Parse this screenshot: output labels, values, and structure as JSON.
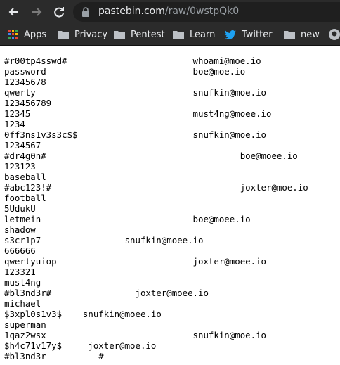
{
  "browser": {
    "url_host": "pastebin.com",
    "url_path": "/raw/0wstpQk0"
  },
  "bookmarks": [
    {
      "label": "Apps",
      "icon": "apps-grid-icon"
    },
    {
      "label": "Privacy",
      "icon": "folder-icon"
    },
    {
      "label": "Pentest",
      "icon": "folder-icon"
    },
    {
      "label": "Learn",
      "icon": "folder-icon"
    },
    {
      "label": "Twitter",
      "icon": "twitter-icon"
    },
    {
      "label": "new",
      "icon": "folder-icon"
    }
  ],
  "lines": [
    "#r00tp4sswd#                        whoami@moe.io",
    "password                            boe@moe.io",
    "12345678",
    "qwerty                              snufkin@moe.io",
    "123456789",
    "12345                               must4ng@moee.io",
    "1234",
    "0ff3ns1v3s3c$$                      snufkin@moe.io",
    "1234567",
    "#dr4g0n#                                     boe@moee.io",
    "123123",
    "baseball",
    "#abc123!#                                    joxter@moe.io",
    "football",
    "5UdukU",
    "letmein                             boe@moee.io",
    "shadow",
    "s3cr1p7                snufkin@moee.io",
    "666666",
    "qwertyuiop                          joxter@moee.io",
    "123321",
    "must4ng",
    "#bl3nd3r#                joxter@moee.io",
    "michael",
    "$3xpl0s1v3$    snufkin@moee.io",
    "superman",
    "1qaz2wsx                            snufkin@moe.io",
    "$h4c71v17y$     joxter@moe.io",
    "#bl3nd3r          #"
  ]
}
